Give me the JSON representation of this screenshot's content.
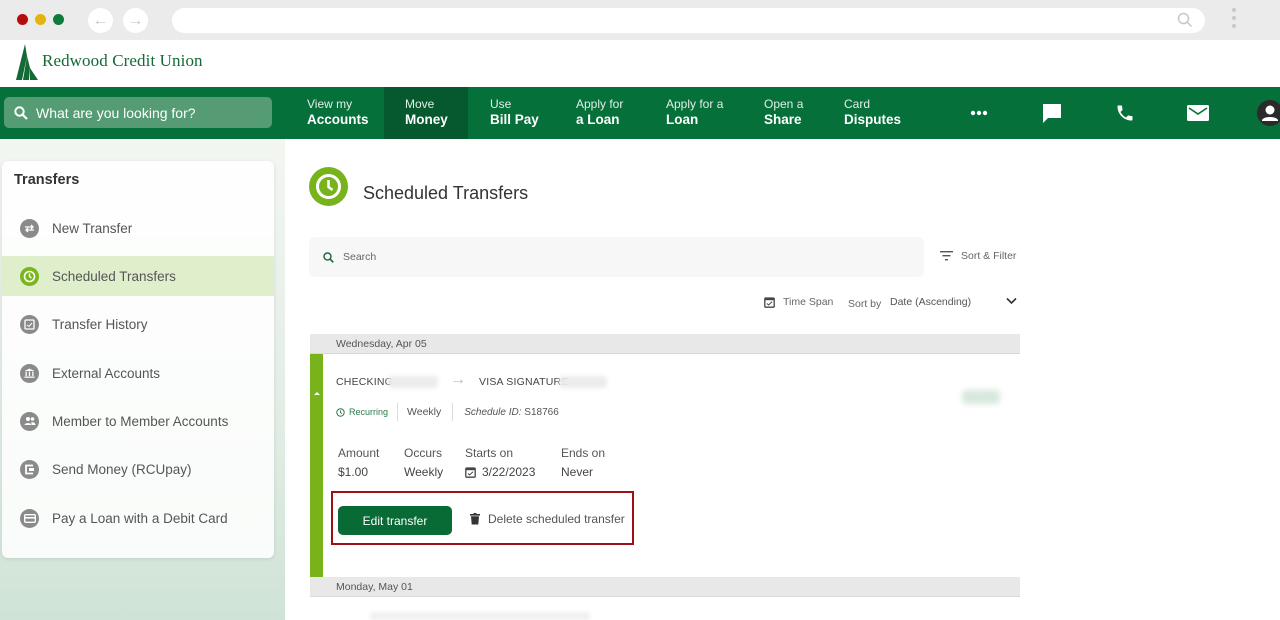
{
  "browser": {
    "back_icon": "arrow-left-icon",
    "forward_icon": "arrow-right-icon",
    "url": ""
  },
  "brand": {
    "name": "Redwood Credit Union",
    "primary_color": "#05703a",
    "accent_color": "#78b31c"
  },
  "header": {
    "search_placeholder": "What are you looking for?",
    "nav": [
      {
        "line1": "View my",
        "line2": "Accounts"
      },
      {
        "line1": "Move",
        "line2": "Money",
        "active": true
      },
      {
        "line1": "Use",
        "line2": "Bill Pay"
      },
      {
        "line1": "Apply for",
        "line2": "a Loan"
      },
      {
        "line1": "Apply for a",
        "line2": "Loan"
      },
      {
        "line1": "Open a",
        "line2": "Share"
      },
      {
        "line1": "Card",
        "line2": "Disputes"
      }
    ],
    "icons": [
      "more-icon",
      "chat-icon",
      "phone-icon",
      "mail-icon",
      "user-icon"
    ]
  },
  "sidebar": {
    "title": "Transfers",
    "items": [
      {
        "label": "New Transfer",
        "icon": "transfer-arrows-icon"
      },
      {
        "label": "Scheduled Transfers",
        "icon": "clock-icon",
        "active": true
      },
      {
        "label": "Transfer History",
        "icon": "history-icon"
      },
      {
        "label": "External Accounts",
        "icon": "bank-icon"
      },
      {
        "label": "Member to Member Accounts",
        "icon": "members-icon"
      },
      {
        "label": "Send Money (RCUpay)",
        "icon": "send-money-icon"
      },
      {
        "label": "Pay a Loan with a Debit Card",
        "icon": "card-icon"
      }
    ]
  },
  "main": {
    "title": "Scheduled Transfers",
    "search_placeholder": "Search",
    "sort_filter_label": "Sort & Filter",
    "time_span_label": "Time Span",
    "sort_by_label": "Sort by",
    "sort_by_value": "Date (Ascending)",
    "groups": [
      {
        "date": "Wednesday, Apr 05",
        "transfer": {
          "from_account": "CHECKING",
          "to_account": "VISA SIGNATURE",
          "type": "Recurring",
          "frequency": "Weekly",
          "schedule_id_label": "Schedule ID:",
          "schedule_id": "S18766",
          "fields": [
            {
              "label": "Amount",
              "value": "$1.00"
            },
            {
              "label": "Occurs",
              "value": "Weekly"
            },
            {
              "label": "Starts on",
              "value": "3/22/2023"
            },
            {
              "label": "Ends on",
              "value": "Never"
            }
          ],
          "edit_label": "Edit transfer",
          "delete_label": "Delete scheduled transfer"
        }
      },
      {
        "date": "Monday, May 01"
      }
    ]
  }
}
